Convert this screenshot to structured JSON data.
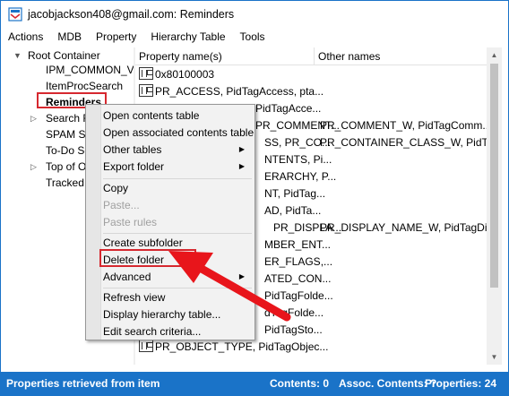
{
  "window": {
    "title": "jacobjackson408@gmail.com: Reminders"
  },
  "menubar": {
    "items": [
      "Actions",
      "MDB",
      "Property",
      "Hierarchy Table",
      "Tools"
    ]
  },
  "tree": {
    "root": "Root Container",
    "items": [
      "IPM_COMMON_V",
      "ItemProcSearch",
      "Reminders",
      "Search R",
      "SPAM Se",
      "To-Do Se",
      "Top of O",
      "Tracked"
    ]
  },
  "table": {
    "columns": [
      "Property name(s)",
      "Other names"
    ],
    "rows": [
      {
        "name": "0x80100003",
        "other": ""
      },
      {
        "name": "PR_ACCESS, PidTagAccess, pta...",
        "other": ""
      },
      {
        "name": "PidTagAcce...",
        "other": ""
      },
      {
        "name": "PR_COMMENT...",
        "other": "PR_COMMENT_W, PidTagComm..."
      },
      {
        "name": "SS, PR_CO...",
        "other": "PR_CONTAINER_CLASS_W, PidTa..."
      },
      {
        "name": "NTENTS, Pi...",
        "other": ""
      },
      {
        "name": "ERARCHY, P...",
        "other": ""
      },
      {
        "name": "NT, PidTag...",
        "other": ""
      },
      {
        "name": "AD, PidTa...",
        "other": ""
      },
      {
        "name": "PR_DISPLA...",
        "other": "PR_DISPLAY_NAME_W, PidTagDis..."
      },
      {
        "name": "MBER_ENT...",
        "other": ""
      },
      {
        "name": "ER_FLAGS,...",
        "other": ""
      },
      {
        "name": "ATED_CON...",
        "other": ""
      },
      {
        "name": "PidTagFolde...",
        "other": ""
      },
      {
        "name": "dTagFolde...",
        "other": ""
      },
      {
        "name": "PidTagSto...",
        "other": ""
      },
      {
        "name": "PR_OBJECT_TYPE, PidTagObjec...",
        "other": ""
      }
    ]
  },
  "context_menu": {
    "open_contents_table": "Open contents table",
    "open_associated_contents_table": "Open associated contents table",
    "other_tables": "Other tables",
    "export_folder": "Export folder",
    "copy": "Copy",
    "paste": "Paste...",
    "paste_rules": "Paste rules",
    "create_subfolder": "Create subfolder",
    "delete_folder": "Delete folder",
    "advanced": "Advanced",
    "refresh_view": "Refresh view",
    "display_hierarchy_table": "Display hierarchy table...",
    "edit_search_criteria": "Edit search criteria..."
  },
  "statusbar": {
    "message": "Properties retrieved from item",
    "contents": "Contents: 0",
    "assoc_contents": "Assoc. Contents: ?",
    "properties": "Properties: 24"
  },
  "colors": {
    "accent": "#1a73c8",
    "highlight_red": "#d6282f",
    "arrow_red": "#e8151b"
  }
}
